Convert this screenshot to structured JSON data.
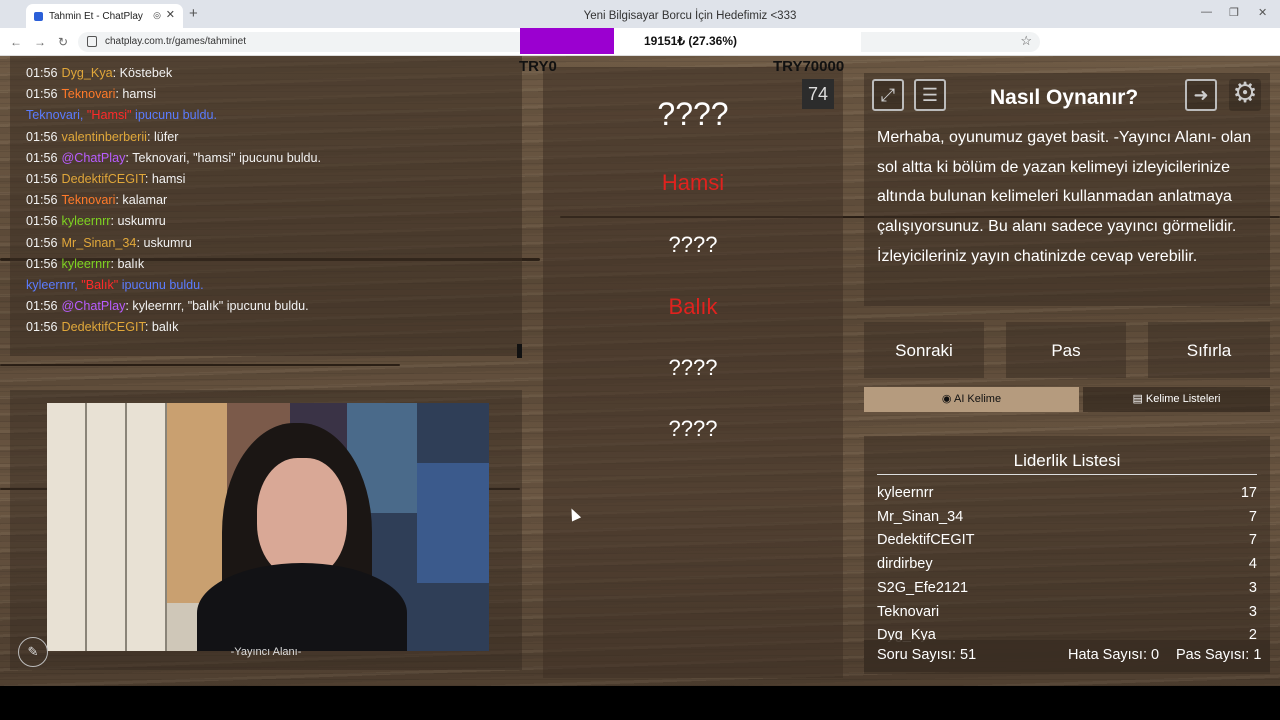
{
  "browser": {
    "tab_title": "Tahmin Et - ChatPlay",
    "window_title": "Yeni Bilgisayar Borcu İçin Hedefimiz <333",
    "url": "chatplay.com.tr/games/tahminet",
    "icons": [
      "back-icon",
      "forward-icon",
      "reload-icon",
      "site-info-icon",
      "bookmark-star-icon"
    ]
  },
  "donation": {
    "text": "19151₺ (27.36%)",
    "progress_percent": 27.36,
    "fill_color": "#9b00d0"
  },
  "chat": {
    "lines": [
      {
        "time": "01:56",
        "user": "Dyg_Kya",
        "sep": ": ",
        "msg": "Köstebek",
        "color": "gold"
      },
      {
        "time": "01:56",
        "user": "Teknovari",
        "sep": ": ",
        "msg": "hamsi",
        "color": "orange"
      },
      {
        "time": "",
        "user": "Teknovari, ",
        "sep": "\"Hamsi\"",
        "msg": " ipucunu buldu.",
        "color": "blue"
      },
      {
        "time": "01:56",
        "user": "valentinberberii",
        "sep": ": ",
        "msg": "lüfer",
        "color": "gold"
      },
      {
        "time": "01:56",
        "user": "@ChatPlay",
        "sep": ": ",
        "msg": "Teknovari, \"hamsi\" ipucunu buldu.",
        "color": "purple"
      },
      {
        "time": "01:56",
        "user": "DedektifCEGIT",
        "sep": ": ",
        "msg": "hamsi",
        "color": "gold"
      },
      {
        "time": "01:56",
        "user": "Teknovari",
        "sep": ": ",
        "msg": "kalamar",
        "color": "orange"
      },
      {
        "time": "01:56",
        "user": "kyleernrr",
        "sep": ": ",
        "msg": "uskumru",
        "color": "green"
      },
      {
        "time": "01:56",
        "user": "Mr_Sinan_34",
        "sep": ": ",
        "msg": "uskumru",
        "color": "gold"
      },
      {
        "time": "01:56",
        "user": "kyleernrr",
        "sep": ": ",
        "msg": "balık",
        "color": "green"
      },
      {
        "time": "",
        "user": "kyleernrr, ",
        "sep": "\"Balık\"",
        "msg": " ipucunu buldu.",
        "color": "blue"
      },
      {
        "time": "01:56",
        "user": "@ChatPlay",
        "sep": ": ",
        "msg": "kyleernrr, \"balık\" ipucunu buldu.",
        "color": "purple"
      },
      {
        "time": "01:56",
        "user": "DedektifCEGIT",
        "sep": ": ",
        "msg": "balık",
        "color": "gold"
      }
    ]
  },
  "streamer": {
    "label": "-Yayıncı Alanı-"
  },
  "board": {
    "try_left": "TRY0",
    "try_right": "TRY70000",
    "timer": "74",
    "words": [
      {
        "text": "????",
        "found": false
      },
      {
        "text": "Hamsi",
        "found": true
      },
      {
        "text": "????",
        "found": false
      },
      {
        "text": "Balık",
        "found": true
      },
      {
        "text": "????",
        "found": false
      },
      {
        "text": "????",
        "found": false
      }
    ]
  },
  "info": {
    "title": "Nasıl Oynanır?",
    "text": "Merhaba, oyunumuz gayet basit. -Yayıncı Alanı- olan sol altta ki bölüm de yazan kelimeyi izleyicilerinize altında bulunan kelimeleri kullanmadan anlatmaya çalışıyorsunuz. Bu alanı sadece yayıncı görmelidir. İzleyicileriniz yayın chatinizde cevap verebilir.",
    "icons": [
      "fullscreen-icon",
      "document-icon",
      "exit-icon",
      "gear-icon"
    ]
  },
  "actions": {
    "next": "Sonraki",
    "pass": "Pas",
    "reset": "Sıfırla",
    "ai_word": "AI Kelime",
    "word_lists": "Kelime Listeleri"
  },
  "leaderboard": {
    "title": "Liderlik Listesi",
    "rows": [
      {
        "name": "kyleernrr",
        "score": "17"
      },
      {
        "name": "Mr_Sinan_34",
        "score": "7"
      },
      {
        "name": "DedektifCEGIT",
        "score": "7"
      },
      {
        "name": "dirdirbey",
        "score": "4"
      },
      {
        "name": "S2G_Efe2121",
        "score": "3"
      },
      {
        "name": "Teknovari",
        "score": "3"
      },
      {
        "name": "Dyg_Kya",
        "score": "2"
      }
    ]
  },
  "stats": {
    "questions": "Soru Sayısı: 51",
    "errors": "Hata Sayısı: 0",
    "passes": "Pas Sayısı: 1"
  }
}
